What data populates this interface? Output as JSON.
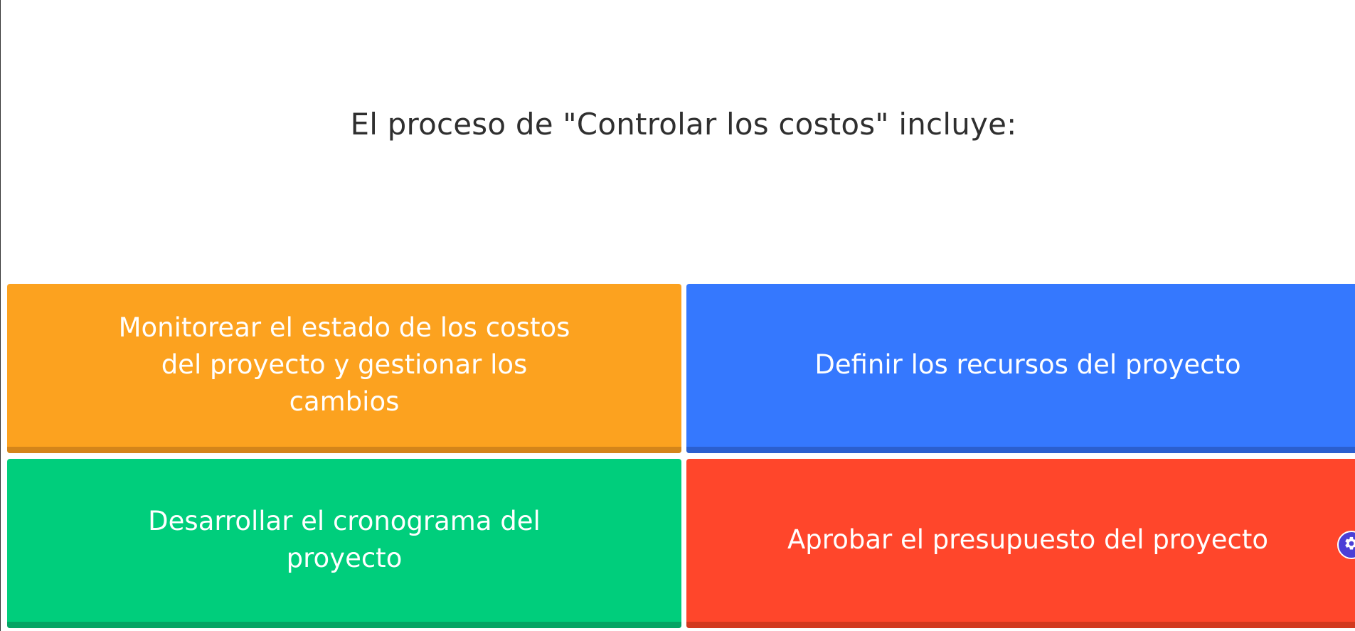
{
  "question": {
    "text": "El proceso de \"Controlar los costos\" incluye:"
  },
  "answers": [
    {
      "label": "Monitorear el estado de los costos del proyecto y gestionar los cambios",
      "color": "#FCA21F",
      "shadow_color": "#D4851A"
    },
    {
      "label": "Definir los recursos del proyecto",
      "color": "#3578FE",
      "shadow_color": "#2B5FCF"
    },
    {
      "label": "Desarrollar el cronograma del proyecto",
      "color": "#00CE7C",
      "shadow_color": "#05A464"
    },
    {
      "label": "Aprobar el presupuesto del proyecto",
      "color": "#FF462B",
      "shadow_color": "#D2381F"
    }
  ],
  "settings": {
    "icon": "gear-icon",
    "color": "#4B3FD6"
  }
}
